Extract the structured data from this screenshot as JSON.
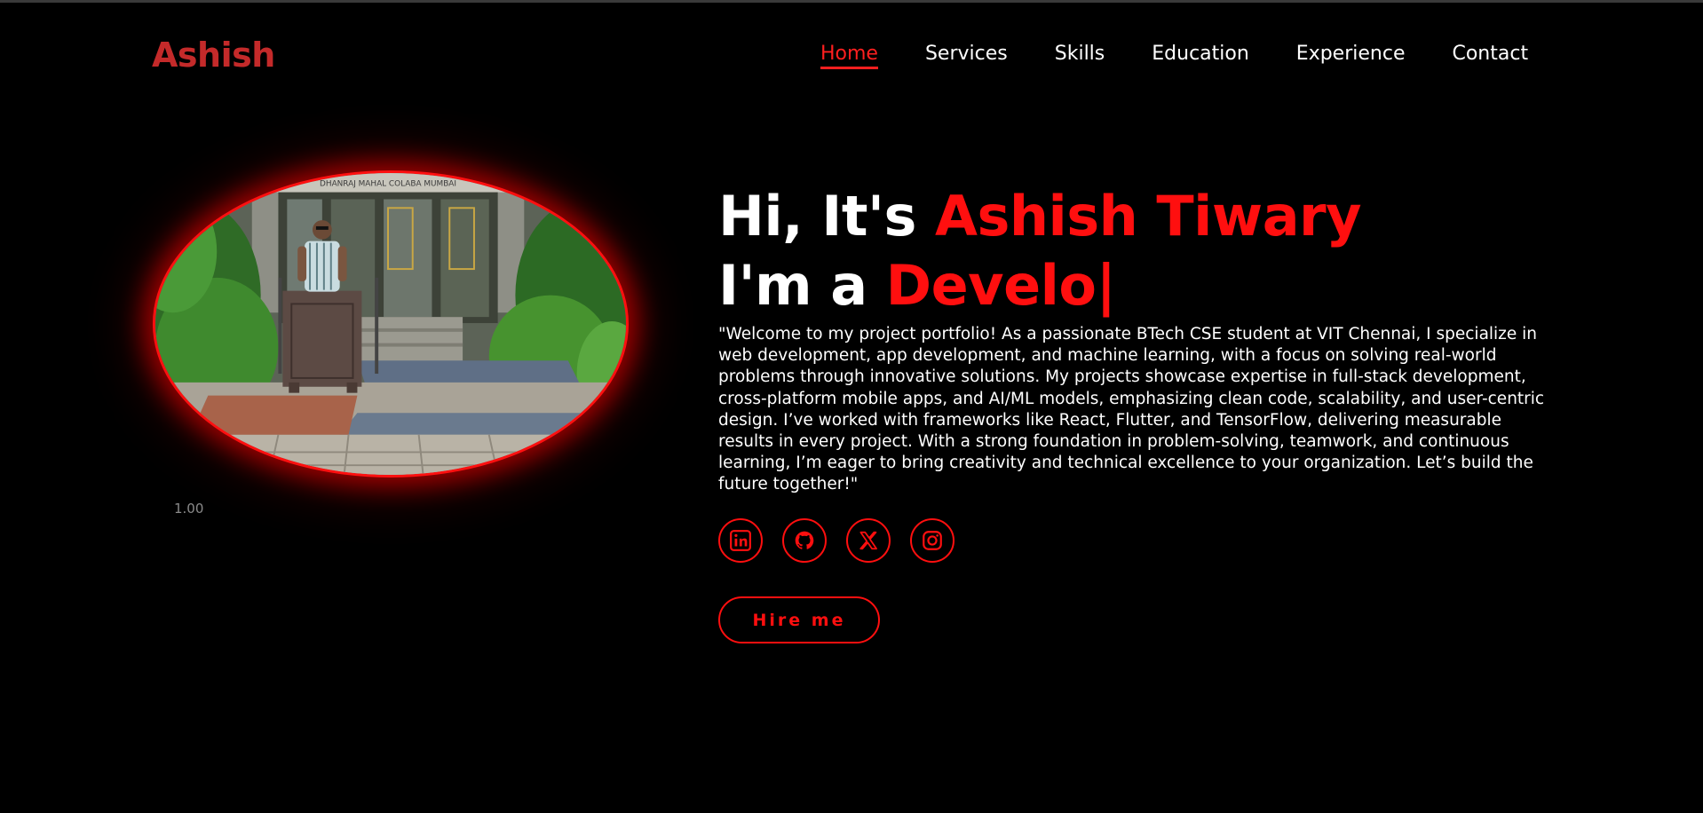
{
  "header": {
    "logo": "Ashish",
    "nav": [
      {
        "label": "Home",
        "active": true
      },
      {
        "label": "Services"
      },
      {
        "label": "Skills"
      },
      {
        "label": "Education"
      },
      {
        "label": "Experience"
      },
      {
        "label": "Contact"
      }
    ]
  },
  "hero": {
    "greeting_prefix": "Hi, It's ",
    "name": "Ashish Tiwary",
    "role_prefix": "I'm a ",
    "role_typed": "Develo|",
    "intro": "\"Welcome to my project portfolio! As a passionate BTech CSE student at VIT Chennai, I specialize in web development, app development, and machine learning, with a focus on solving real-world problems through innovative solutions. My projects showcase expertise in full-stack development, cross-platform mobile apps, and AI/ML models, emphasizing clean code, scalability, and user-centric design. I’ve worked with frameworks like React, Flutter, and TensorFlow, delivering measurable results in every project. With a strong foundation in problem-solving, teamwork, and continuous learning, I’m eager to bring creativity and technical excellence to your organization. Let’s build the future together!\"",
    "image_sign_text": "DHANRAJ MAHAL COLABA MUMBAI",
    "zoom_readout": "1.00",
    "hire_label": "Hire me"
  },
  "socials": [
    {
      "icon": "linkedin-icon"
    },
    {
      "icon": "github-icon"
    },
    {
      "icon": "x-icon"
    },
    {
      "icon": "instagram-icon"
    }
  ],
  "colors": {
    "accent": "#ff0f0f",
    "logo": "#c42a2a",
    "background": "#000000"
  }
}
